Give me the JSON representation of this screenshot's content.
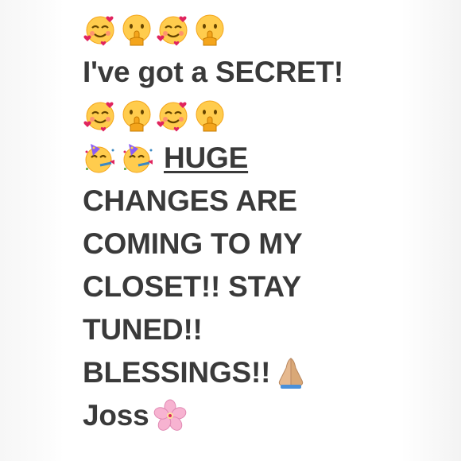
{
  "post": {
    "emoji_row_1": [
      "smiling-face-with-hearts-icon",
      "shushing-face-icon",
      "smiling-face-with-hearts-icon",
      "shushing-face-icon"
    ],
    "line_1": "I've got a SECRET!",
    "emoji_row_2": [
      "smiling-face-with-hearts-icon",
      "shushing-face-icon",
      "smiling-face-with-hearts-icon",
      "shushing-face-icon"
    ],
    "party_emojis": [
      "partying-face-icon",
      "partying-face-icon"
    ],
    "huge": "HUGE",
    "line_3": "CHANGES ARE",
    "line_4": "COMING TO MY",
    "line_5": "CLOSET!! STAY",
    "line_6": "TUNED!!",
    "line_7": "BLESSINGS!!",
    "line_7_emoji": "folded-hands-icon",
    "signature": "Joss",
    "signature_emoji": "cherry-blossom-icon"
  },
  "colors": {
    "text": "#3a3a3a",
    "background": "#ffffff"
  }
}
